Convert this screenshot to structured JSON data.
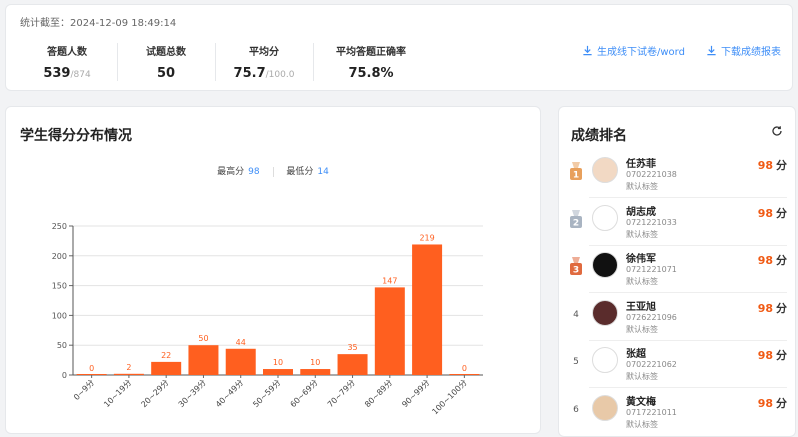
{
  "header": {
    "cutoff_label": "统计截至：",
    "cutoff_time": "2024-12-09 18:49:14"
  },
  "stats": {
    "participants_label": "答题人数",
    "participants_value": "539",
    "participants_total": "/874",
    "questions_label": "试题总数",
    "questions_value": "50",
    "avg_label": "平均分",
    "avg_value": "75.7",
    "avg_total": "/100.0",
    "accuracy_label": "平均答题正确率",
    "accuracy_value": "75.8%"
  },
  "actions": {
    "offline_label": "生成线下试卷/word",
    "report_label": "下载成绩报表"
  },
  "chart_section": {
    "title": "学生得分分布情况",
    "max_label": "最高分",
    "max_value": "98",
    "min_label": "最低分",
    "min_value": "14"
  },
  "chart_data": {
    "type": "bar",
    "categories": [
      "0~9分",
      "10~19分",
      "20~29分",
      "30~39分",
      "40~49分",
      "50~59分",
      "60~69分",
      "70~79分",
      "80~89分",
      "90~99分",
      "100~100分"
    ],
    "values": [
      0,
      2,
      22,
      50,
      44,
      10,
      10,
      35,
      147,
      219,
      0
    ],
    "ylim": [
      0,
      250
    ],
    "yticks": [
      0,
      50,
      100,
      150,
      200,
      250
    ],
    "bar_color": "#ff5f1f",
    "grid": true
  },
  "ranking": {
    "title": "成绩排名",
    "score_unit": "分",
    "items": [
      {
        "rank": "1",
        "name": "任苏菲",
        "id": "0702221038",
        "tag": "默认标签",
        "score": "98"
      },
      {
        "rank": "2",
        "name": "胡志成",
        "id": "0721221033",
        "tag": "默认标签",
        "score": "98"
      },
      {
        "rank": "3",
        "name": "徐伟军",
        "id": "0721221071",
        "tag": "默认标签",
        "score": "98"
      },
      {
        "rank": "4",
        "name": "王亚旭",
        "id": "0726221096",
        "tag": "默认标签",
        "score": "98"
      },
      {
        "rank": "5",
        "name": "张超",
        "id": "0702221062",
        "tag": "默认标签",
        "score": "98"
      },
      {
        "rank": "6",
        "name": "黄文梅",
        "id": "0717221011",
        "tag": "默认标签",
        "score": "98"
      }
    ]
  },
  "colors": {
    "accent": "#3e8ef7",
    "score": "#f05a14",
    "gold": "#e8a05c",
    "silver": "#a9b4c2",
    "bronze": "#e06a3f"
  }
}
